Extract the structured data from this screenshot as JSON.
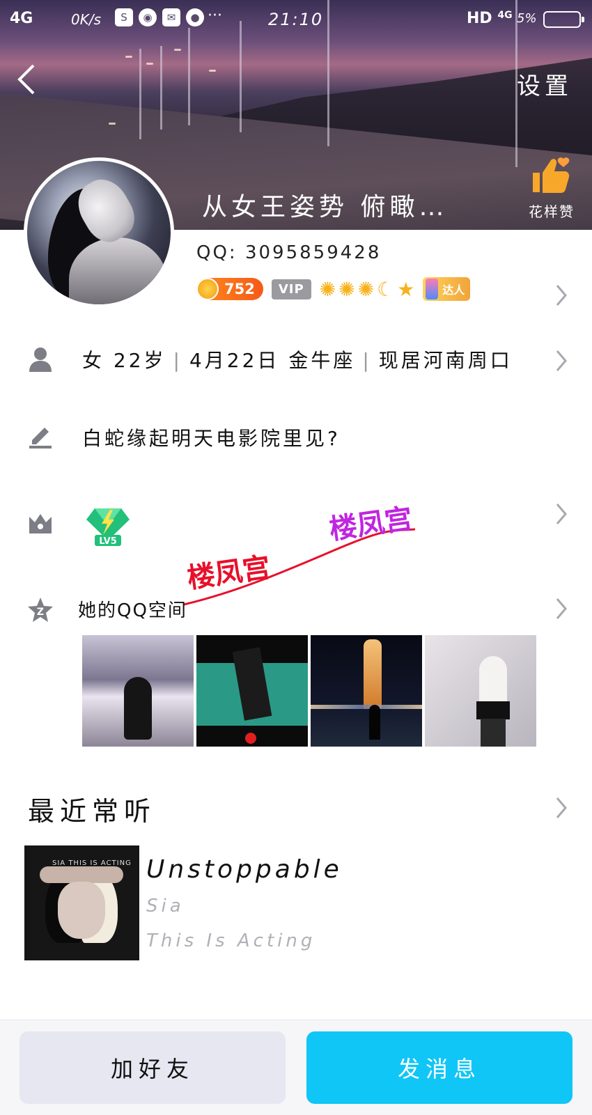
{
  "status_bar": {
    "network": "4G",
    "speed": "0K/s",
    "time": "21:10",
    "hd": "HD",
    "network_right": "4G",
    "battery": "5%",
    "more": "···"
  },
  "header": {
    "settings_label": "设置",
    "nickname": "从女王姿势 俯瞰…",
    "like_label": "花样赞"
  },
  "profile": {
    "qq_id": "QQ: 3095859428",
    "coin_value": "752",
    "vip_label": "VIP",
    "level_icons": [
      "sun",
      "sun",
      "sun",
      "moon",
      "star"
    ],
    "master_label": "达人",
    "gender_age": "女 22岁",
    "birthday": "4月22日 金牛座",
    "location": "现居河南周口",
    "signature": "白蛇缘起明天电影院里见?",
    "gem_level": "LV5"
  },
  "watermarks": [
    "楼凤宫",
    "楼凤宫"
  ],
  "qzone": {
    "title": "她的QQ空间",
    "photos": [
      "photo-1",
      "photo-2",
      "photo-3",
      "photo-4"
    ]
  },
  "recent_music": {
    "title": "最近常听",
    "song": "Unstoppable",
    "artist": "Sia",
    "album": "This Is Acting",
    "album_cover_text": "SIA THIS IS ACTING"
  },
  "actions": {
    "add_friend": "加好友",
    "send_message": "发消息"
  },
  "colors": {
    "primary": "#10c6f6",
    "secondary_button": "#e6e7f1",
    "watermark_red": "#e8102a",
    "watermark_purple": "#c025e0",
    "coin": "#f45a18"
  }
}
